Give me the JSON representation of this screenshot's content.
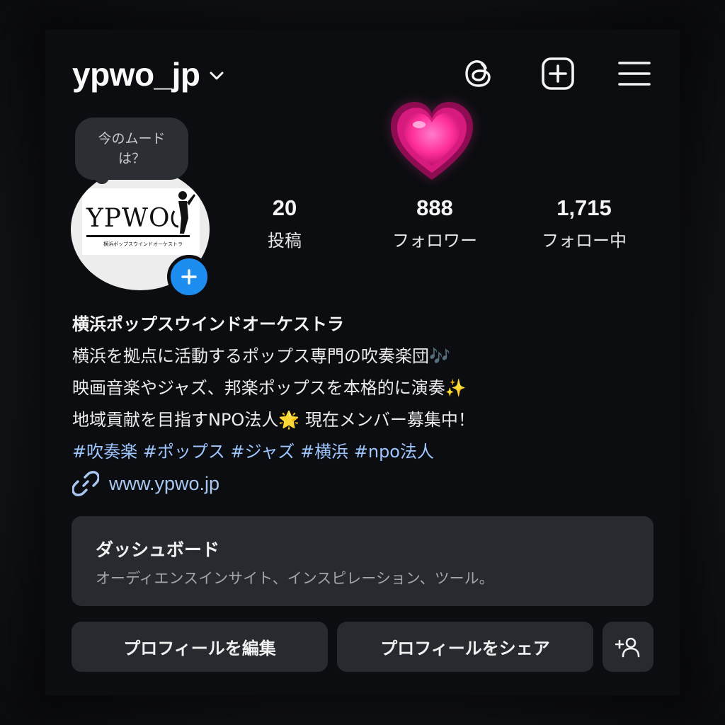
{
  "header": {
    "username": "ypwo_jp",
    "icons": [
      "threads-icon",
      "create-post-icon",
      "menu-icon"
    ]
  },
  "mood_bubble": {
    "line1": "今のムード",
    "line2": "は？"
  },
  "avatar": {
    "logo_text": "YPWO",
    "logo_subtitle": "横浜ポップスウインドオーケストラ"
  },
  "stats": [
    {
      "value": "20",
      "label": "投稿"
    },
    {
      "value": "888",
      "label": "フォロワー"
    },
    {
      "value": "1,715",
      "label": "フォロー中"
    }
  ],
  "bio": {
    "name": "横浜ポップスウインドオーケストラ",
    "line1": "横浜を拠点に活動するポップス専門の吹奏楽団🎶",
    "line2": "映画音楽やジャズ、邦楽ポップスを本格的に演奏✨",
    "line3": "地域貢献を目指すNPO法人🌟 現在メンバー募集中！",
    "hashtags": "#吹奏楽 #ポップス #ジャズ #横浜 #npo法人"
  },
  "link": {
    "url": "www.ypwo.jp"
  },
  "dashboard": {
    "title": "ダッシュボード",
    "subtitle": "オーディエンスインサイト、インスピレーション、ツール。"
  },
  "buttons": {
    "edit_profile": "プロフィールを編集",
    "share_profile": "プロフィールをシェア"
  },
  "colors": {
    "background": "#0b0d10",
    "card": "#272a2f",
    "link": "#a8c8f2",
    "hashtag": "#9ec6ff",
    "accent_blue": "#1d8ef0",
    "heart_pink": "#ff3ea5"
  }
}
